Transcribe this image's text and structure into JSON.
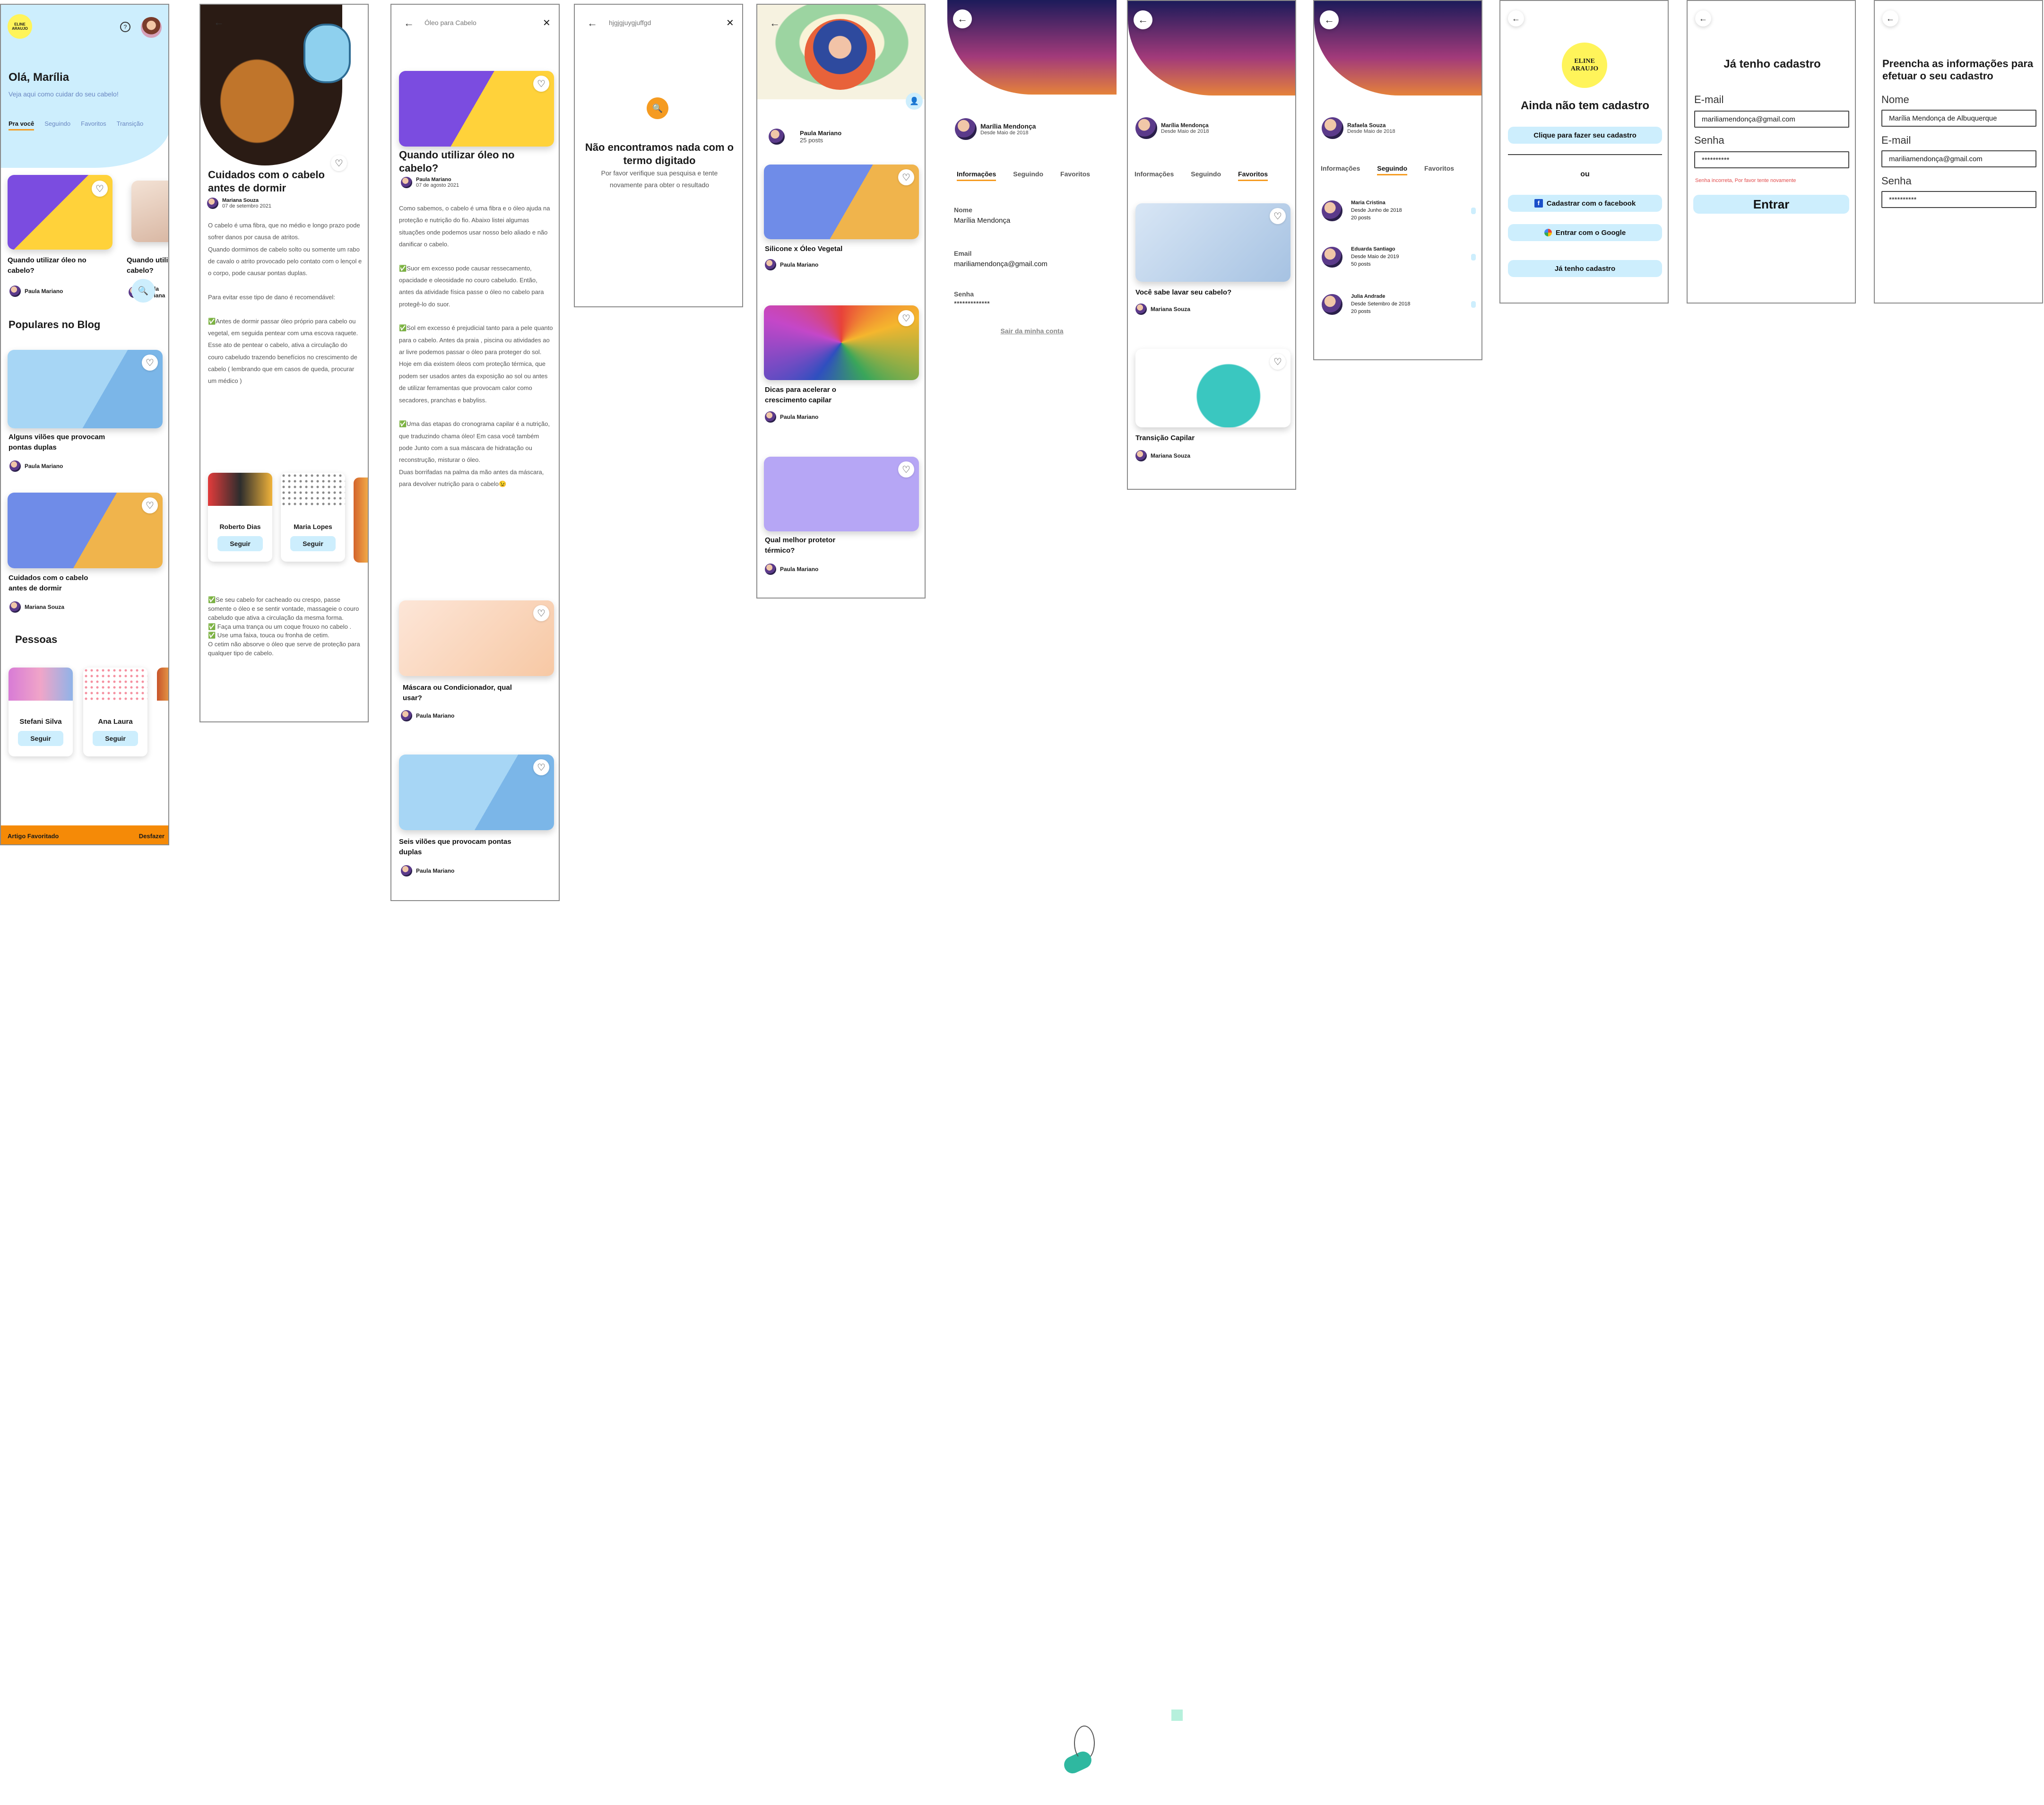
{
  "colors": {
    "accent": "#f59b21",
    "sky": "#cdeefd",
    "logo": "#fff45a",
    "toast": "#f58a07",
    "frame": "#8a8a8a"
  },
  "home": {
    "logo": "ELINE ARAUJO",
    "greeting": "Olá, Marília",
    "subtitle": "Veja aqui como cuidar do seu cabelo!",
    "tabs": [
      "Pra você",
      "Seguindo",
      "Favoritos",
      "Transição"
    ],
    "featured": [
      {
        "title": "Quando utilizar óleo no cabelo?",
        "author": "Paula Mariano"
      },
      {
        "title": "Quando utili cabelo?",
        "author": "Paula Mariana"
      }
    ],
    "popular_heading": "Populares no Blog",
    "popular": [
      {
        "title": "Alguns vilões que provocam pontas duplas",
        "author": "Paula Mariano"
      },
      {
        "title": "Cuidados com o cabelo antes de dormir",
        "author": "Mariana Souza"
      }
    ],
    "people_heading": "Pessoas",
    "people": [
      "Stefani Silva",
      "Ana Laura"
    ],
    "follow_label": "Seguir",
    "toast": "Artigo Favoritado",
    "undo": "Desfazer"
  },
  "article1": {
    "title": "Cuidados com o cabelo antes de dormir",
    "author": "Mariana Souza",
    "date": "07 de setembro 2021",
    "body1": "O cabelo é uma fibra, que no médio e longo prazo pode sofrer danos por causa de atritos.\nQuando dormimos de cabelo solto ou somente um rabo de cavalo o atrito provocado pelo contato com o lençol e o corpo, pode causar pontas duplas.\n\nPara evitar esse tipo de dano é recomendável:\n\n✅Antes de dormir passar óleo próprio para cabelo ou vegetal, em seguida pentear com uma escova raquete. Esse ato de pentear o cabelo, ativa a circulação do couro cabeludo trazendo benefícios no crescimento de cabelo ( lembrando que em casos de queda, procurar um médico )",
    "people": [
      "Roberto Dias",
      "Maria Lopes"
    ],
    "follow_label": "Seguir",
    "body2": "✅Se seu cabelo for cacheado ou crespo, passe somente o óleo e se sentir vontade, massageie o couro cabeludo que ativa a circulação da mesma forma.\n✅ Faça uma trança ou um coque frouxo no cabelo .\n✅ Use uma faixa, touca ou fronha de cetim.\nO cetim não absorve o óleo que serve de proteção para qualquer tipo de cabelo."
  },
  "article2": {
    "search": "Óleo para Cabelo",
    "title": "Quando utilizar óleo no cabelo?",
    "author": "Paula Mariano",
    "date": "07 de agosto 2021",
    "body": "Como sabemos, o cabelo é uma fibra e o óleo ajuda na proteção e nutrição do fio. Abaixo listei algumas situações onde podemos usar nosso belo aliado e não danificar o cabelo.\n\n✅Suor em excesso pode causar ressecamento, opacidade e oleosidade no couro cabeludo. Então, antes da atividade física passe o óleo no cabelo para protegê-lo do suor.\n\n✅Sol em excesso é prejudicial tanto para a pele quanto para o cabelo. Antes da praia , piscina ou atividades ao ar livre podemos passar o óleo para proteger do sol. Hoje em dia existem óleos com proteção térmica, que podem ser usados antes da exposição ao sol ou antes de utilizar ferramentas que provocam calor como secadores, pranchas e babyliss.\n\n✅Uma das etapas do cronograma capilar é a nutrição, que traduzindo chama óleo! Em casa você também pode Junto com a sua máscara de hidratação ou reconstrução, misturar o óleo.\nDuas borrifadas na palma da mão antes da máscara, para devolver nutrição para o cabelo😉",
    "related": [
      {
        "title": "Máscara ou Condicionador, qual usar?",
        "author": "Paula Mariano"
      },
      {
        "title": "Seis vilões que provocam pontas duplas",
        "author": "Paula Mariano"
      }
    ]
  },
  "search_empty": {
    "query": "hjgjgjuygjuffgd",
    "title": "Não encontramos nada com o termo digitado",
    "text": "Por favor verifique sua pesquisa e tente novamente para obter o resultado"
  },
  "author_page": {
    "name": "Paula Mariano",
    "posts": "25 posts",
    "articles": [
      {
        "title": "Silicone x Óleo Vegetal",
        "author": "Paula Mariano"
      },
      {
        "title": "Dicas para acelerar o crescimento capilar",
        "author": "Paula Mariano"
      },
      {
        "title": "Qual melhor protetor térmico?",
        "author": "Paula Mariano"
      }
    ]
  },
  "profile": {
    "name": "Marília Mendonça",
    "since": "Desde Maio de 2018",
    "tabs": [
      "Informações",
      "Seguindo",
      "Favoritos"
    ],
    "name_label": "Nome",
    "name_value": "Marília Mendonça",
    "email_label": "Email",
    "email_value": "mariliamendonça@gmail.com",
    "password_label": "Senha",
    "password_value": "*************",
    "logout": "Sair da minha conta"
  },
  "favorites": {
    "items": [
      {
        "title": "Você sabe lavar seu cabelo?",
        "author": "Mariana Souza"
      },
      {
        "title": "Transição Capilar",
        "author": "Mariana Souza"
      }
    ]
  },
  "following": {
    "name": "Rafaela Souza",
    "since": "Desde Maio de 2018",
    "people": [
      {
        "name": "Maria Cristina",
        "since": "Desde Junho de 2018",
        "posts": "20 posts"
      },
      {
        "name": "Eduarda Santiago",
        "since": "Desde Maio de 2019",
        "posts": "50 posts"
      },
      {
        "name": "Julia Andrade",
        "since": "Desde Setembro de 2018",
        "posts": "20 posts"
      }
    ]
  },
  "signup_choice": {
    "logo": "ELINE ARAUJO",
    "title": "Ainda não tem cadastro",
    "signup_button": "Clique para fazer seu cadastro",
    "or": "ou",
    "facebook_button": "Cadastrar com o facebook",
    "google_button": "Entrar com o Google",
    "login_button": "Já tenho cadastro"
  },
  "login": {
    "title": "Já tenho cadastro",
    "email_label": "E-mail",
    "email_value": "mariliamendonça@gmail.com",
    "password_label": "Senha",
    "password_value": "**********",
    "error": "Senha incorreta, Por favor tente novamente",
    "submit": "Entrar"
  },
  "register": {
    "title": "Preencha as informações para efetuar o seu cadastro",
    "name_label": "Nome",
    "name_value": "Marília Mendonça de Albuquerque",
    "email_label": "E-mail",
    "email_value": "mariliamendonça@gmail.com",
    "password_label": "Senha",
    "password_value": "**********"
  }
}
